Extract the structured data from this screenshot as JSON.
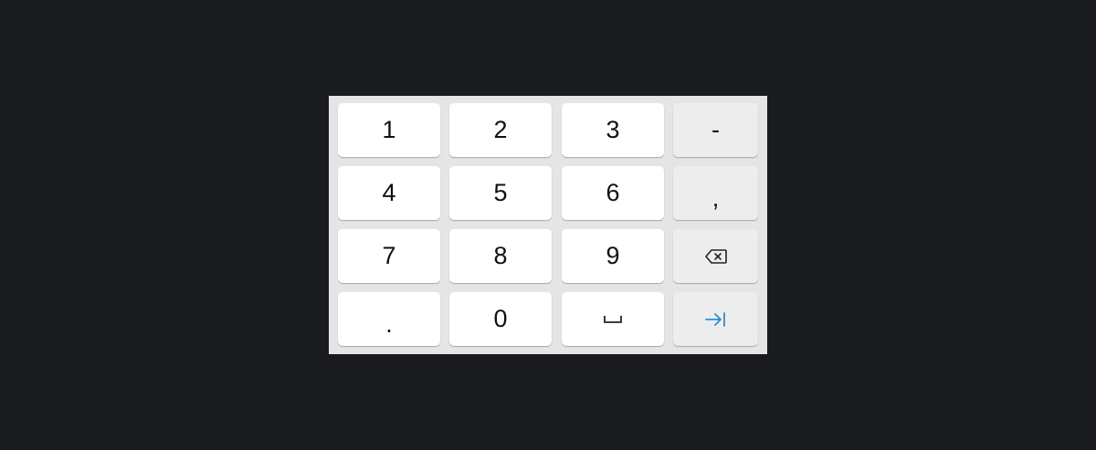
{
  "keyboard": {
    "rows": [
      [
        "1",
        "2",
        "3",
        "-"
      ],
      [
        "4",
        "5",
        "6",
        ","
      ],
      [
        "7",
        "8",
        "9",
        ""
      ],
      [
        ".",
        "0",
        "",
        ""
      ]
    ],
    "icons": {
      "backspace": "backspace-icon",
      "space": "space-icon",
      "tab": "tab-next-icon"
    }
  },
  "colors": {
    "background": "#1a1b1f",
    "keyboard_bg": "#e5e5e5",
    "number_key": "#ffffff",
    "function_key": "#ededed",
    "accent": "#2a8fd0"
  }
}
